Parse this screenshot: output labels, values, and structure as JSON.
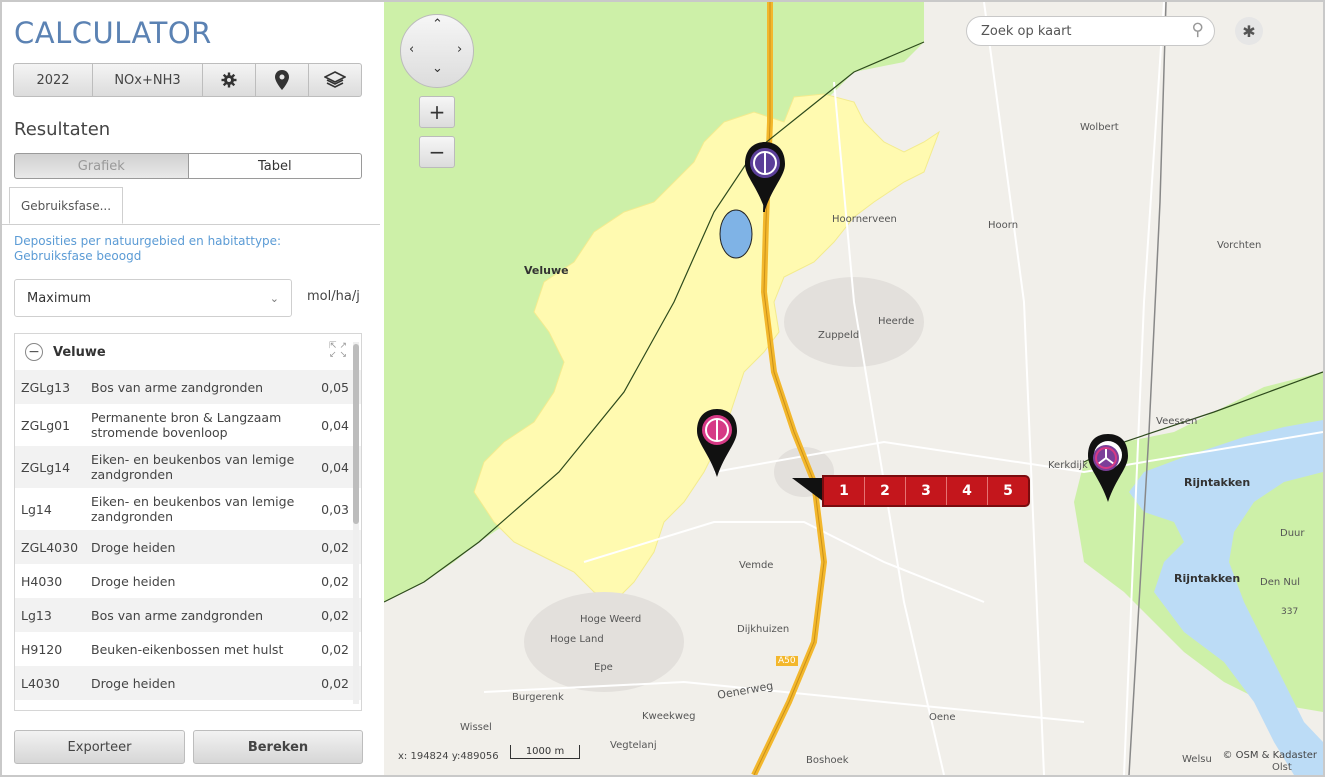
{
  "app": {
    "title": "CALCULATOR"
  },
  "toolbar": {
    "year": "2022",
    "substance": "NOx+NH3",
    "icons": [
      "gear-icon",
      "location-pin-icon",
      "layers-icon"
    ]
  },
  "results": {
    "title": "Resultaten",
    "views": [
      "Grafiek",
      "Tabel"
    ],
    "active_view": "Tabel",
    "tab": "Gebruiksfase...",
    "description": "Deposities per natuurgebied en habitattype: Gebruiksfase beoogd",
    "select_value": "Maximum",
    "unit": "mol/ha/j"
  },
  "list": {
    "title": "Veluwe",
    "rows": [
      {
        "code": "ZGLg13",
        "name": "Bos van arme zandgronden",
        "value": "0,05"
      },
      {
        "code": "ZGLg01",
        "name": "Permanente bron & Langzaam stromende bovenloop",
        "value": "0,04"
      },
      {
        "code": "ZGLg14",
        "name": "Eiken- en beukenbos van lemige zandgronden",
        "value": "0,04"
      },
      {
        "code": "Lg14",
        "name": "Eiken- en beukenbos van lemige zandgronden",
        "value": "0,03"
      },
      {
        "code": "ZGL4030",
        "name": "Droge heiden",
        "value": "0,02"
      },
      {
        "code": "H4030",
        "name": "Droge heiden",
        "value": "0,02"
      },
      {
        "code": "Lg13",
        "name": "Bos van arme zandgronden",
        "value": "0,02"
      },
      {
        "code": "H9120",
        "name": "Beuken-eikenbossen met hulst",
        "value": "0,02"
      },
      {
        "code": "L4030",
        "name": "Droge heiden",
        "value": "0,02"
      }
    ]
  },
  "buttons": {
    "export": "Exporteer",
    "calculate": "Bereken"
  },
  "map": {
    "search_placeholder": "Zoek op kaart",
    "zoom_in": "+",
    "zoom_out": "−",
    "coordinates": "x: 194824 y:489056",
    "scale_label": "1000 m",
    "attribution": "© OSM & Kadaster",
    "marker_numbers": [
      "1",
      "2",
      "3",
      "4",
      "5"
    ],
    "places": {
      "veluwe": "Veluwe",
      "hoornerveen": "Hoornerveen",
      "hoorn": "Hoorn",
      "wolbert": "Wolbert",
      "vorchten": "Vorchten",
      "zuppeld": "Zuppeld",
      "heerde": "Heerde",
      "veessen": "Veessen",
      "kerkdijk": "Kerkdijk",
      "rijntakken": "Rijntakken",
      "rijntakken2": "Rijntakken",
      "duur": "Duur",
      "dennul": "Den Nul",
      "vemde": "Vemde",
      "hogeweerd": "Hoge Weerd",
      "hogeland": "Hoge Land",
      "dijkhuizen": "Dijkhuizen",
      "epe": "Epe",
      "burgerenk": "Burgerenk",
      "kweekweg": "Kweekweg",
      "oenerweg": "Oenerweg",
      "wissel": "Wissel",
      "vegtelanj": "Vegtelanj",
      "oene": "Oene",
      "boshoek": "Boshoek",
      "welsu": "Welsu",
      "olst": "Olst",
      "a50": "A50",
      "n337": "337"
    },
    "colors": {
      "nature_area": "#cdf0a8",
      "deposition": "#fffab0",
      "road": "#f3b72c",
      "water": "#bcdcf6",
      "marker_red": "#c4161c",
      "pin_purple": "#5b3f99",
      "pin_pink": "#d63a86"
    }
  }
}
